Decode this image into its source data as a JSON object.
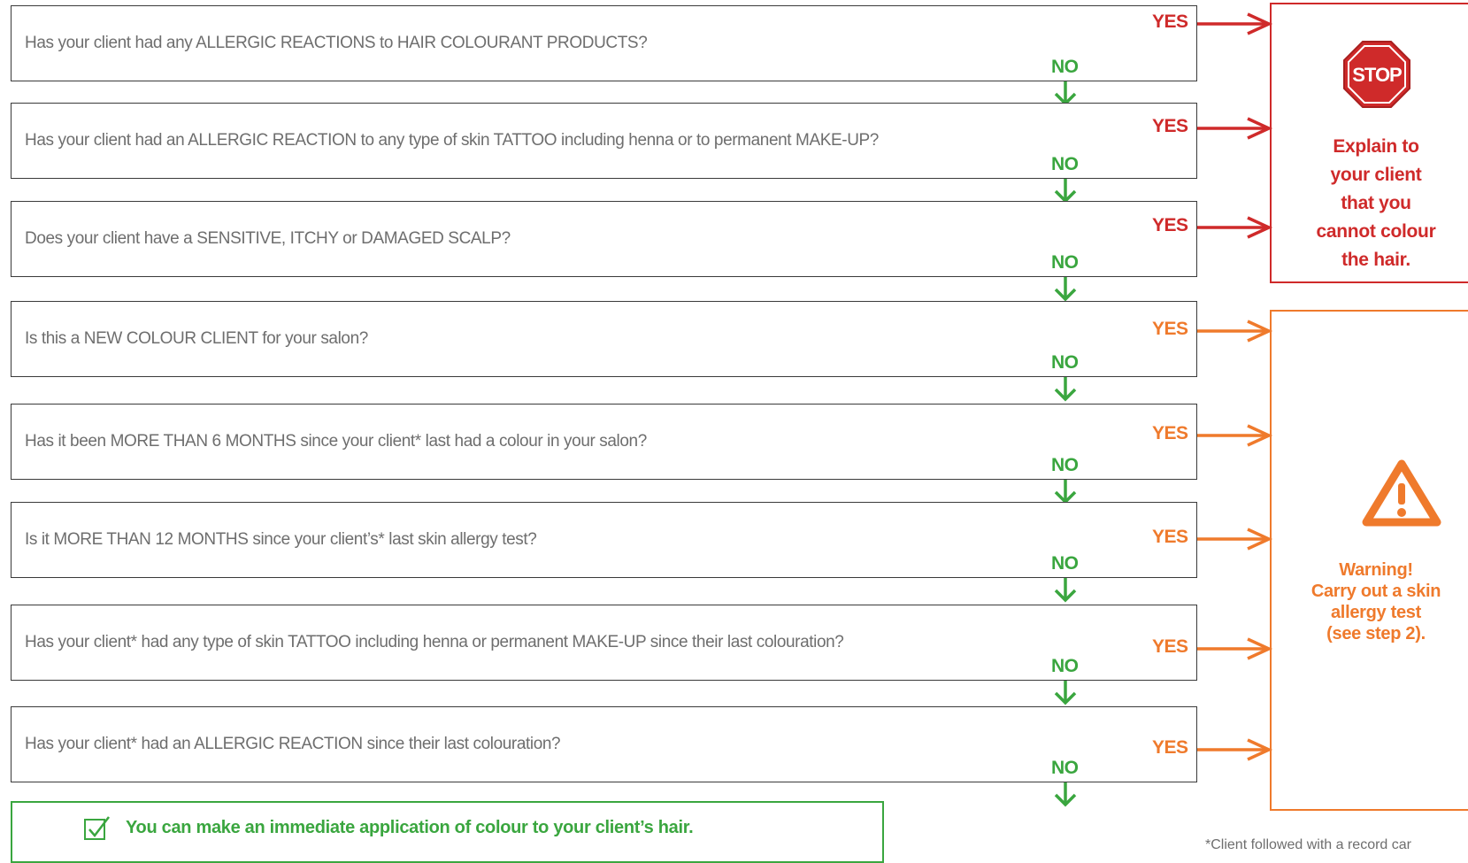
{
  "questions": [
    {
      "text": "Has your client had any ALLERGIC REACTIONS to HAIR COLOURANT PRODUCTS?",
      "yes": "YES",
      "no": "NO",
      "outcome": "stop"
    },
    {
      "text": "Has your client had an ALLERGIC REACTION to any type of skin TATTOO including henna or to permanent MAKE-UP?",
      "yes": "YES",
      "no": "NO",
      "outcome": "stop"
    },
    {
      "text": "Does your client have a SENSITIVE, ITCHY or DAMAGED SCALP?",
      "yes": "YES",
      "no": "NO",
      "outcome": "stop"
    },
    {
      "text": "Is this a NEW COLOUR CLIENT for your salon?",
      "yes": "YES",
      "no": "NO",
      "outcome": "warning"
    },
    {
      "text": "Has it been MORE THAN 6 MONTHS since your client* last had a colour in your salon?",
      "yes": "YES",
      "no": "NO",
      "outcome": "warning"
    },
    {
      "text": "Is it MORE THAN 12 MONTHS since your client’s* last skin allergy test?",
      "yes": "YES",
      "no": "NO",
      "outcome": "warning"
    },
    {
      "text": "Has your client* had any type of skin TATTOO including henna or permanent MAKE-UP since their last colouration?",
      "yes": "YES",
      "no": "NO",
      "outcome": "warning"
    },
    {
      "text": "Has your client* had an ALLERGIC REACTION since their last colouration?",
      "yes": "YES",
      "no": "NO",
      "outcome": "warning"
    }
  ],
  "stop": {
    "sign_label": "STOP",
    "icon": "stop-sign-icon",
    "lines": [
      "Explain to",
      "your client",
      "that you",
      "cannot colour",
      "the hair."
    ]
  },
  "warning": {
    "icon": "warning-triangle-icon",
    "lines": [
      "Warning!",
      "Carry out a skin",
      "allergy test",
      "(see step 2)."
    ]
  },
  "proceed": {
    "icon": "checkbox-checked-icon",
    "text": "You can make an immediate application of colour to your client’s hair."
  },
  "footnote": "*Client followed with a record car",
  "colors": {
    "stop_red": "#cf2a2a",
    "warning_orange": "#ef7a2c",
    "no_green": "#3aa63f",
    "question_text": "#6e6e6e",
    "box_border": "#3a3a3a"
  }
}
